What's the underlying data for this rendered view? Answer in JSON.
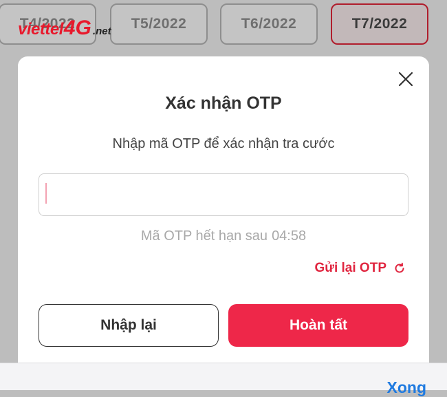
{
  "months": {
    "tabs": [
      {
        "label": "T4/2022",
        "active": false
      },
      {
        "label": "T5/2022",
        "active": false
      },
      {
        "label": "T6/2022",
        "active": false
      },
      {
        "label": "T7/2022",
        "active": true
      }
    ]
  },
  "logo": {
    "part1": "viettel",
    "part2": "4G",
    "part3": ".net"
  },
  "dialog": {
    "title": "Xác nhận OTP",
    "subtitle": "Nhập mã OTP để xác nhận tra cước",
    "otp_input": {
      "value": "",
      "placeholder": ""
    },
    "expiry_label": "Mã OTP hết hạn sau",
    "expiry_timer": "04:58",
    "resend_label": "Gửi lại OTP",
    "buttons": {
      "reset": "Nhập lại",
      "done": "Hoàn tất"
    },
    "close_icon": "close-icon",
    "resend_icon": "refresh-icon"
  },
  "keyboard": {
    "done_label": "Xong"
  },
  "colors": {
    "accent": "#ee2749",
    "resend_text": "#e0253f",
    "link_blue": "#1f7ae0",
    "active_tab_border": "#b01d2c"
  }
}
